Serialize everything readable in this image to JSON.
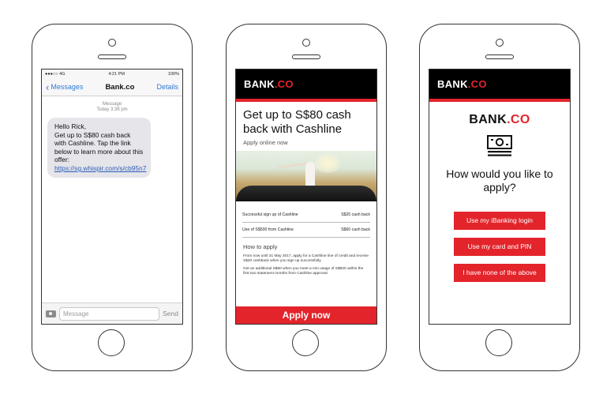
{
  "colors": {
    "brand_red": "#e3242b",
    "ios_blue": "#2f7bd6",
    "bubble_gray": "#e5e5ea"
  },
  "phone1": {
    "status": {
      "carrier": "●●●○○ 4G",
      "time": "4:21 PM",
      "battery": "100%"
    },
    "nav": {
      "back_label": "Messages",
      "title": "Bank.co",
      "details_label": "Details"
    },
    "meta": {
      "label": "Message",
      "time": "Today 3:38 pm"
    },
    "bubble": {
      "line1": "Hello Rick,",
      "line2": "Get up to S$80 cash back with Cashline. Tap the link below to learn more about this offer:",
      "link": "https://sg.whispir.com/s/cb95n7"
    },
    "composer": {
      "placeholder": "Message",
      "send_label": "Send"
    }
  },
  "phone2": {
    "brand": {
      "name": "BANK",
      "suffix": ".CO"
    },
    "title": "Get up to S$80 cash back with Cashline",
    "subtitle": "Apply online now",
    "rows": [
      {
        "label": "Successful sign up of Cashline",
        "value": "S$20 cash back"
      },
      {
        "label": "Use of S$500 from Cashline",
        "value": "S$60 cash back"
      }
    ],
    "how_to_title": "How to apply",
    "para1": "From now until 31 May 2017, apply for a Cashline line of credit and receive S$20 cashback when you sign up successfully.",
    "para2": "Get an additional S$60 when you meet a min usage of S$500 within the first two statement months from Cashline approval.",
    "apply_label": "Apply now"
  },
  "phone3": {
    "brand": {
      "name": "BANK",
      "suffix": ".CO"
    },
    "question": "How would you like to apply?",
    "options": [
      "Use my iBanking login",
      "Use my card and PIN",
      "I have none of the above"
    ]
  }
}
